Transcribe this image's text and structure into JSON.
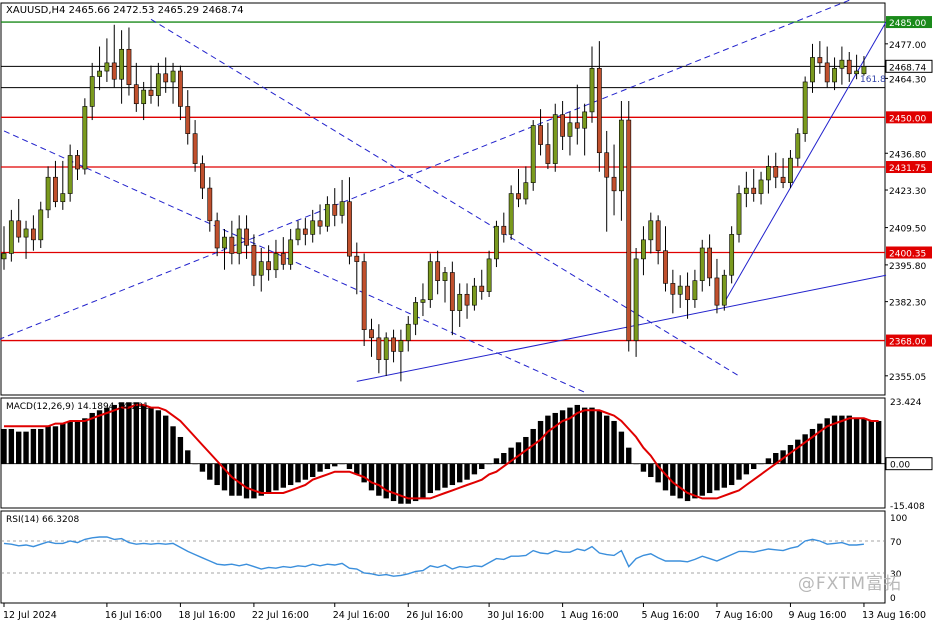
{
  "chart_data": {
    "type": "candlestick",
    "symbol_header": "XAUUSD,H4  2465.66 2472.53 2465.29 2468.74",
    "price_axis": {
      "range": [
        2348,
        2492
      ],
      "ticks": [
        "2477.00",
        "2464.30",
        "2436.80",
        "2423.30",
        "2409.50",
        "2395.80",
        "2382.30",
        "2355.05"
      ]
    },
    "price_lines": [
      {
        "price": 2485.0,
        "label": "2485.00",
        "color": "#1a8a1a",
        "label_bg": "#1a8a1a",
        "label_color": "#ffffff"
      },
      {
        "price": 2468.74,
        "label": "2468.74",
        "color": "#000000",
        "label_bg": "#ffffff",
        "label_color": "#000000",
        "boxed": true
      },
      {
        "price": 2460.9,
        "label": "",
        "color": "#000000"
      },
      {
        "price": 2450.0,
        "label": "2450.00",
        "color": "#e00000",
        "label_bg": "#e00000",
        "label_color": "#ffffff"
      },
      {
        "price": 2431.75,
        "label": "2431.75",
        "color": "#e00000",
        "label_bg": "#e00000",
        "label_color": "#ffffff"
      },
      {
        "price": 2400.35,
        "label": "2400.35",
        "color": "#e00000",
        "label_bg": "#e00000",
        "label_color": "#ffffff"
      },
      {
        "price": 2368.0,
        "label": "2368.00",
        "color": "#e00000",
        "label_bg": "#e00000",
        "label_color": "#ffffff"
      }
    ],
    "fib_label": "161.8",
    "candles": [
      {
        "o": 2398,
        "h": 2410,
        "l": 2394,
        "c": 2400
      },
      {
        "o": 2400,
        "h": 2416,
        "l": 2397,
        "c": 2412
      },
      {
        "o": 2412,
        "h": 2420,
        "l": 2404,
        "c": 2406
      },
      {
        "o": 2406,
        "h": 2412,
        "l": 2398,
        "c": 2409
      },
      {
        "o": 2409,
        "h": 2414,
        "l": 2401,
        "c": 2405
      },
      {
        "o": 2405,
        "h": 2419,
        "l": 2402,
        "c": 2416
      },
      {
        "o": 2416,
        "h": 2432,
        "l": 2413,
        "c": 2428
      },
      {
        "o": 2428,
        "h": 2434,
        "l": 2417,
        "c": 2419
      },
      {
        "o": 2419,
        "h": 2434,
        "l": 2416,
        "c": 2422
      },
      {
        "o": 2422,
        "h": 2440,
        "l": 2419,
        "c": 2436
      },
      {
        "o": 2436,
        "h": 2438,
        "l": 2427,
        "c": 2431
      },
      {
        "o": 2431,
        "h": 2457,
        "l": 2429,
        "c": 2454
      },
      {
        "o": 2454,
        "h": 2470,
        "l": 2449,
        "c": 2465
      },
      {
        "o": 2465,
        "h": 2476,
        "l": 2460,
        "c": 2467
      },
      {
        "o": 2467,
        "h": 2479,
        "l": 2463,
        "c": 2470
      },
      {
        "o": 2470,
        "h": 2484,
        "l": 2461,
        "c": 2464
      },
      {
        "o": 2464,
        "h": 2482,
        "l": 2455,
        "c": 2475
      },
      {
        "o": 2475,
        "h": 2483,
        "l": 2458,
        "c": 2462
      },
      {
        "o": 2462,
        "h": 2470,
        "l": 2452,
        "c": 2455
      },
      {
        "o": 2455,
        "h": 2463,
        "l": 2449,
        "c": 2460
      },
      {
        "o": 2460,
        "h": 2469,
        "l": 2455,
        "c": 2458
      },
      {
        "o": 2458,
        "h": 2470,
        "l": 2454,
        "c": 2466
      },
      {
        "o": 2466,
        "h": 2472,
        "l": 2459,
        "c": 2463
      },
      {
        "o": 2463,
        "h": 2470,
        "l": 2455,
        "c": 2467
      },
      {
        "o": 2467,
        "h": 2469,
        "l": 2449,
        "c": 2454
      },
      {
        "o": 2454,
        "h": 2460,
        "l": 2440,
        "c": 2444
      },
      {
        "o": 2444,
        "h": 2449,
        "l": 2430,
        "c": 2433
      },
      {
        "o": 2433,
        "h": 2436,
        "l": 2420,
        "c": 2424
      },
      {
        "o": 2424,
        "h": 2428,
        "l": 2408,
        "c": 2412
      },
      {
        "o": 2412,
        "h": 2415,
        "l": 2399,
        "c": 2402
      },
      {
        "o": 2402,
        "h": 2409,
        "l": 2394,
        "c": 2406
      },
      {
        "o": 2406,
        "h": 2412,
        "l": 2396,
        "c": 2400
      },
      {
        "o": 2400,
        "h": 2414,
        "l": 2396,
        "c": 2409
      },
      {
        "o": 2409,
        "h": 2414,
        "l": 2398,
        "c": 2403
      },
      {
        "o": 2403,
        "h": 2407,
        "l": 2388,
        "c": 2392
      },
      {
        "o": 2392,
        "h": 2402,
        "l": 2386,
        "c": 2397
      },
      {
        "o": 2397,
        "h": 2403,
        "l": 2390,
        "c": 2394
      },
      {
        "o": 2394,
        "h": 2405,
        "l": 2391,
        "c": 2400
      },
      {
        "o": 2400,
        "h": 2406,
        "l": 2394,
        "c": 2396
      },
      {
        "o": 2396,
        "h": 2409,
        "l": 2394,
        "c": 2405
      },
      {
        "o": 2405,
        "h": 2412,
        "l": 2403,
        "c": 2409
      },
      {
        "o": 2409,
        "h": 2413,
        "l": 2403,
        "c": 2407
      },
      {
        "o": 2407,
        "h": 2416,
        "l": 2404,
        "c": 2412
      },
      {
        "o": 2412,
        "h": 2418,
        "l": 2407,
        "c": 2410
      },
      {
        "o": 2410,
        "h": 2421,
        "l": 2408,
        "c": 2418
      },
      {
        "o": 2418,
        "h": 2424,
        "l": 2410,
        "c": 2414
      },
      {
        "o": 2414,
        "h": 2427,
        "l": 2411,
        "c": 2419
      },
      {
        "o": 2419,
        "h": 2428,
        "l": 2396,
        "c": 2399
      },
      {
        "o": 2399,
        "h": 2404,
        "l": 2385,
        "c": 2397
      },
      {
        "o": 2397,
        "h": 2400,
        "l": 2366,
        "c": 2372
      },
      {
        "o": 2372,
        "h": 2376,
        "l": 2362,
        "c": 2369
      },
      {
        "o": 2369,
        "h": 2374,
        "l": 2356,
        "c": 2361
      },
      {
        "o": 2361,
        "h": 2371,
        "l": 2355,
        "c": 2369
      },
      {
        "o": 2369,
        "h": 2372,
        "l": 2360,
        "c": 2364
      },
      {
        "o": 2364,
        "h": 2372,
        "l": 2353,
        "c": 2368
      },
      {
        "o": 2368,
        "h": 2377,
        "l": 2364,
        "c": 2374
      },
      {
        "o": 2374,
        "h": 2384,
        "l": 2370,
        "c": 2382
      },
      {
        "o": 2382,
        "h": 2389,
        "l": 2377,
        "c": 2383
      },
      {
        "o": 2383,
        "h": 2400,
        "l": 2380,
        "c": 2397
      },
      {
        "o": 2397,
        "h": 2401,
        "l": 2385,
        "c": 2390
      },
      {
        "o": 2390,
        "h": 2395,
        "l": 2382,
        "c": 2393
      },
      {
        "o": 2393,
        "h": 2397,
        "l": 2370,
        "c": 2379
      },
      {
        "o": 2379,
        "h": 2389,
        "l": 2373,
        "c": 2385
      },
      {
        "o": 2385,
        "h": 2389,
        "l": 2376,
        "c": 2381
      },
      {
        "o": 2381,
        "h": 2391,
        "l": 2379,
        "c": 2388
      },
      {
        "o": 2388,
        "h": 2394,
        "l": 2383,
        "c": 2386
      },
      {
        "o": 2386,
        "h": 2401,
        "l": 2384,
        "c": 2398
      },
      {
        "o": 2398,
        "h": 2412,
        "l": 2395,
        "c": 2410
      },
      {
        "o": 2410,
        "h": 2415,
        "l": 2404,
        "c": 2407
      },
      {
        "o": 2407,
        "h": 2425,
        "l": 2405,
        "c": 2422
      },
      {
        "o": 2422,
        "h": 2431,
        "l": 2417,
        "c": 2420
      },
      {
        "o": 2420,
        "h": 2432,
        "l": 2418,
        "c": 2426
      },
      {
        "o": 2426,
        "h": 2449,
        "l": 2423,
        "c": 2447
      },
      {
        "o": 2447,
        "h": 2453,
        "l": 2436,
        "c": 2440
      },
      {
        "o": 2440,
        "h": 2448,
        "l": 2431,
        "c": 2433
      },
      {
        "o": 2433,
        "h": 2455,
        "l": 2430,
        "c": 2451
      },
      {
        "o": 2451,
        "h": 2456,
        "l": 2438,
        "c": 2443
      },
      {
        "o": 2443,
        "h": 2452,
        "l": 2436,
        "c": 2448
      },
      {
        "o": 2448,
        "h": 2462,
        "l": 2440,
        "c": 2446
      },
      {
        "o": 2446,
        "h": 2455,
        "l": 2436,
        "c": 2452
      },
      {
        "o": 2452,
        "h": 2476,
        "l": 2448,
        "c": 2468
      },
      {
        "o": 2468,
        "h": 2478,
        "l": 2430,
        "c": 2437
      },
      {
        "o": 2437,
        "h": 2445,
        "l": 2408,
        "c": 2428
      },
      {
        "o": 2428,
        "h": 2440,
        "l": 2414,
        "c": 2423
      },
      {
        "o": 2423,
        "h": 2456,
        "l": 2412,
        "c": 2449
      },
      {
        "o": 2449,
        "h": 2456,
        "l": 2364,
        "c": 2368
      },
      {
        "o": 2368,
        "h": 2402,
        "l": 2362,
        "c": 2398
      },
      {
        "o": 2398,
        "h": 2410,
        "l": 2392,
        "c": 2405
      },
      {
        "o": 2405,
        "h": 2415,
        "l": 2400,
        "c": 2412
      },
      {
        "o": 2412,
        "h": 2414,
        "l": 2396,
        "c": 2401
      },
      {
        "o": 2401,
        "h": 2410,
        "l": 2386,
        "c": 2389
      },
      {
        "o": 2389,
        "h": 2394,
        "l": 2378,
        "c": 2385
      },
      {
        "o": 2385,
        "h": 2392,
        "l": 2380,
        "c": 2388
      },
      {
        "o": 2388,
        "h": 2393,
        "l": 2376,
        "c": 2383
      },
      {
        "o": 2383,
        "h": 2394,
        "l": 2380,
        "c": 2390
      },
      {
        "o": 2390,
        "h": 2405,
        "l": 2386,
        "c": 2402
      },
      {
        "o": 2402,
        "h": 2407,
        "l": 2388,
        "c": 2391
      },
      {
        "o": 2391,
        "h": 2398,
        "l": 2378,
        "c": 2381
      },
      {
        "o": 2381,
        "h": 2394,
        "l": 2379,
        "c": 2392
      },
      {
        "o": 2392,
        "h": 2410,
        "l": 2389,
        "c": 2407
      },
      {
        "o": 2407,
        "h": 2425,
        "l": 2404,
        "c": 2422
      },
      {
        "o": 2422,
        "h": 2430,
        "l": 2417,
        "c": 2424
      },
      {
        "o": 2424,
        "h": 2431,
        "l": 2419,
        "c": 2422
      },
      {
        "o": 2422,
        "h": 2430,
        "l": 2418,
        "c": 2427
      },
      {
        "o": 2427,
        "h": 2436,
        "l": 2422,
        "c": 2432
      },
      {
        "o": 2432,
        "h": 2437,
        "l": 2424,
        "c": 2428
      },
      {
        "o": 2428,
        "h": 2435,
        "l": 2424,
        "c": 2426
      },
      {
        "o": 2426,
        "h": 2438,
        "l": 2424,
        "c": 2435
      },
      {
        "o": 2435,
        "h": 2446,
        "l": 2432,
        "c": 2444
      },
      {
        "o": 2444,
        "h": 2465,
        "l": 2441,
        "c": 2463
      },
      {
        "o": 2463,
        "h": 2477,
        "l": 2459,
        "c": 2472
      },
      {
        "o": 2472,
        "h": 2478,
        "l": 2466,
        "c": 2470
      },
      {
        "o": 2470,
        "h": 2476,
        "l": 2461,
        "c": 2463
      },
      {
        "o": 2463,
        "h": 2472,
        "l": 2460,
        "c": 2468
      },
      {
        "o": 2468,
        "h": 2476,
        "l": 2462,
        "c": 2471
      },
      {
        "o": 2471,
        "h": 2474,
        "l": 2463,
        "c": 2466
      },
      {
        "o": 2466,
        "h": 2473,
        "l": 2464,
        "c": 2467
      },
      {
        "o": 2466,
        "h": 2472.5,
        "l": 2465.3,
        "c": 2468.7
      }
    ],
    "trendlines": [
      {
        "points": [
          [
            -2,
            2367
          ],
          [
            115,
            2493
          ]
        ],
        "color": "#2222cc",
        "style": "dashed"
      },
      {
        "points": [
          [
            0,
            2445
          ],
          [
            79,
            2349
          ]
        ],
        "color": "#2222cc",
        "style": "dashed"
      },
      {
        "points": [
          [
            20,
            2486
          ],
          [
            100,
            2355
          ]
        ],
        "color": "#2222cc",
        "style": "dashed"
      },
      {
        "points": [
          [
            48,
            2353
          ],
          [
            120,
            2392
          ]
        ],
        "color": "#2222cc",
        "style": "solid"
      },
      {
        "points": [
          [
            98,
            2382
          ],
          [
            120,
            2485
          ]
        ],
        "color": "#2222cc",
        "style": "solid"
      }
    ],
    "macd": {
      "label": "MACD(12,26,9) 14.1894 14.291",
      "params": "12,26,9",
      "ticks": [
        "23.424",
        "0.00",
        "-15.408"
      ],
      "range": [
        -16.6,
        24.6
      ],
      "histogram": [
        13,
        13,
        12,
        12,
        13,
        13,
        14,
        14,
        15,
        16,
        16,
        17,
        19,
        20,
        21,
        22,
        23,
        23,
        23,
        22,
        21,
        20,
        18,
        14,
        10,
        5,
        0,
        -3,
        -6,
        -8,
        -10,
        -12,
        -12,
        -13,
        -13,
        -12,
        -11,
        -10,
        -9,
        -8,
        -7,
        -6,
        -5,
        -3,
        -2,
        -1,
        0,
        -2,
        -4,
        -7,
        -10,
        -12,
        -13,
        -14,
        -15,
        -15,
        -14,
        -13,
        -11,
        -10,
        -9,
        -8,
        -7,
        -6,
        -4,
        -2,
        0,
        2,
        4,
        6,
        8,
        10,
        13,
        16,
        18,
        19,
        20,
        21,
        22,
        21,
        21,
        20,
        18,
        16,
        12,
        6,
        0,
        -3,
        -5,
        -7,
        -10,
        -12,
        -13,
        -14,
        -13,
        -12,
        -11,
        -10,
        -9,
        -8,
        -6,
        -4,
        -2,
        0,
        2,
        4,
        5,
        7,
        9,
        11,
        13,
        15,
        17,
        18,
        18,
        18,
        17,
        17,
        16,
        16
      ],
      "signal": [
        14,
        14,
        14,
        14,
        14,
        14,
        14,
        15,
        15,
        16,
        16,
        16,
        17,
        18,
        19,
        20,
        21,
        21,
        22,
        22,
        21,
        21,
        20,
        18,
        16,
        13,
        10,
        7,
        4,
        1,
        -2,
        -5,
        -7,
        -9,
        -10,
        -11,
        -11,
        -11,
        -11,
        -10,
        -9,
        -8,
        -6,
        -5,
        -4,
        -3,
        -3,
        -3,
        -4,
        -5,
        -7,
        -8,
        -10,
        -11,
        -12,
        -13,
        -13,
        -13,
        -13,
        -12,
        -11,
        -10,
        -9,
        -8,
        -7,
        -6,
        -4,
        -3,
        -1,
        1,
        3,
        5,
        7,
        9,
        12,
        14,
        16,
        17,
        19,
        20,
        20,
        20,
        19,
        18,
        16,
        13,
        10,
        6,
        3,
        -1,
        -4,
        -7,
        -9,
        -11,
        -12,
        -13,
        -13,
        -13,
        -12,
        -11,
        -10,
        -8,
        -6,
        -4,
        -2,
        0,
        2,
        4,
        6,
        8,
        10,
        12,
        14,
        15,
        16,
        17,
        17,
        17,
        16,
        16
      ]
    },
    "rsi": {
      "label": "RSI(14) 66.3208",
      "period": 14,
      "ticks": [
        "100",
        "70",
        "30",
        "0"
      ],
      "levels": [
        70,
        30
      ],
      "values": [
        67,
        66,
        64,
        65,
        63,
        66,
        69,
        67,
        67,
        70,
        68,
        72,
        74,
        75,
        75,
        72,
        73,
        68,
        66,
        67,
        66,
        67,
        66,
        67,
        62,
        57,
        53,
        49,
        45,
        41,
        40,
        41,
        39,
        41,
        38,
        35,
        37,
        36,
        38,
        37,
        39,
        38,
        41,
        39,
        41,
        40,
        42,
        36,
        35,
        30,
        29,
        27,
        28,
        26,
        27,
        29,
        32,
        33,
        39,
        37,
        40,
        35,
        38,
        37,
        39,
        38,
        43,
        48,
        47,
        51,
        51,
        52,
        58,
        55,
        54,
        58,
        56,
        56,
        60,
        58,
        63,
        55,
        53,
        52,
        58,
        38,
        48,
        52,
        54,
        49,
        45,
        45,
        45,
        44,
        47,
        51,
        48,
        45,
        49,
        53,
        57,
        57,
        56,
        58,
        60,
        59,
        58,
        61,
        63,
        70,
        72,
        70,
        66,
        67,
        68,
        65,
        65,
        66
      ]
    },
    "time_labels": [
      {
        "index": 0,
        "text": "12 Jul 2024"
      },
      {
        "index": 14,
        "text": "16 Jul 16:00"
      },
      {
        "index": 24,
        "text": "18 Jul 16:00"
      },
      {
        "index": 34,
        "text": "22 Jul 16:00"
      },
      {
        "index": 45,
        "text": "24 Jul 16:00"
      },
      {
        "index": 55,
        "text": "26 Jul 16:00"
      },
      {
        "index": 66,
        "text": "30 Jul 16:00"
      },
      {
        "index": 76,
        "text": "1 Aug 16:00"
      },
      {
        "index": 87,
        "text": "5 Aug 16:00"
      },
      {
        "index": 97,
        "text": "7 Aug 16:00"
      },
      {
        "index": 107,
        "text": "9 Aug 16:00"
      },
      {
        "index": 117,
        "text": "13 Aug 16:00"
      }
    ],
    "colors": {
      "bull": "#7a9a1e",
      "bear": "#c0502d",
      "wick": "#000000",
      "macd_hist": "#000000",
      "macd_signal": "#e00000",
      "rsi_line": "#3b8fdc",
      "grid": "#000000"
    }
  },
  "watermark": "@FXTM富拓"
}
